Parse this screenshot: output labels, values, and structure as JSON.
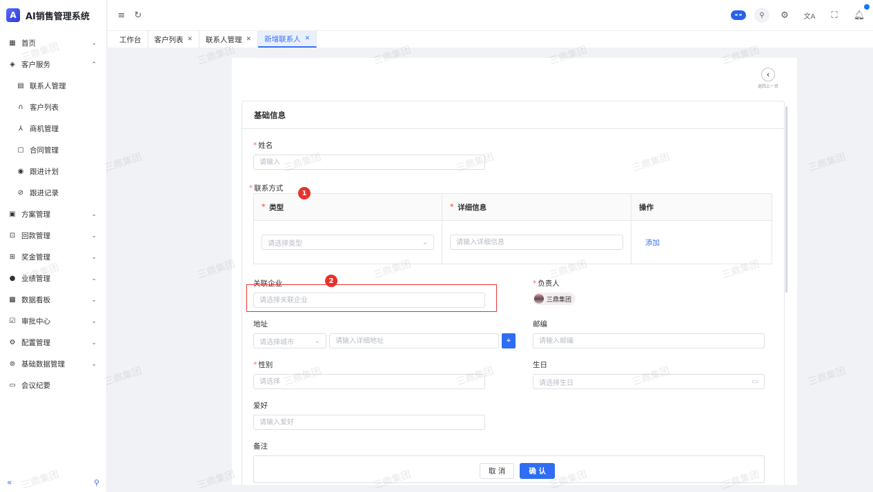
{
  "app": {
    "title": "AI销售管理系统",
    "logo_letter": "A"
  },
  "sidebar": {
    "items": [
      {
        "label": "首页",
        "icon": "grid-icon",
        "chev": "⌄"
      },
      {
        "label": "客户服务",
        "icon": "service-icon",
        "chev": "⌃"
      },
      {
        "label": "联系人管理",
        "icon": "contact-card-icon",
        "sub": true
      },
      {
        "label": "客户列表",
        "icon": "headset-icon",
        "sub": true
      },
      {
        "label": "商机管理",
        "icon": "network-icon",
        "sub": true
      },
      {
        "label": "合同管理",
        "icon": "document-icon",
        "sub": true
      },
      {
        "label": "跟进计划",
        "icon": "target-icon",
        "sub": true
      },
      {
        "label": "跟进记录",
        "icon": "compass-icon",
        "sub": true
      },
      {
        "label": "方案管理",
        "icon": "plan-icon",
        "chev": "⌄"
      },
      {
        "label": "回款管理",
        "icon": "payment-icon",
        "chev": "⌄"
      },
      {
        "label": "奖金管理",
        "icon": "bonus-icon",
        "chev": "⌄"
      },
      {
        "label": "业绩管理",
        "icon": "performance-icon",
        "chev": "⌄"
      },
      {
        "label": "数据看板",
        "icon": "dashboard-icon",
        "chev": "⌄"
      },
      {
        "label": "审批中心",
        "icon": "approval-icon",
        "chev": "⌄"
      },
      {
        "label": "配置管理",
        "icon": "gear-icon",
        "chev": "⌄"
      },
      {
        "label": "基础数据管理",
        "icon": "database-icon",
        "chev": "⌄"
      },
      {
        "label": "会议纪要",
        "icon": "meeting-icon"
      }
    ]
  },
  "tabs": [
    {
      "label": "工作台",
      "closable": false,
      "active": false
    },
    {
      "label": "客户列表",
      "closable": true,
      "active": false
    },
    {
      "label": "联系人管理",
      "closable": true,
      "active": false
    },
    {
      "label": "新增联系人",
      "closable": true,
      "active": true
    }
  ],
  "back": {
    "label": "返回上一页"
  },
  "form": {
    "section_title": "基础信息",
    "name": {
      "label": "姓名",
      "placeholder": "请输入"
    },
    "contact": {
      "label": "联系方式",
      "col_type": "类型",
      "col_detail": "详细信息",
      "col_action": "操作",
      "type_placeholder": "请选择类型",
      "detail_placeholder": "请输入详细信息",
      "add_label": "添加"
    },
    "company": {
      "label": "关联企业",
      "placeholder": "请选择关联企业"
    },
    "owner": {
      "label": "负责人",
      "value": "三鼎集团"
    },
    "address": {
      "label": "地址",
      "city_placeholder": "请选择城市",
      "detail_placeholder": "请输入详细地址"
    },
    "zip": {
      "label": "邮编",
      "placeholder": "请输入邮编"
    },
    "gender": {
      "label": "性别",
      "placeholder": "请选择"
    },
    "birthday": {
      "label": "生日",
      "placeholder": "请选择生日"
    },
    "hobby": {
      "label": "爱好",
      "placeholder": "请输入爱好"
    },
    "remark": {
      "label": "备注"
    }
  },
  "buttons": {
    "cancel": "取 消",
    "confirm": "确 认"
  },
  "markers": [
    "1",
    "2"
  ],
  "watermark": "三鼎集团",
  "colors": {
    "primary": "#2f6df2",
    "required": "#f56c6c",
    "marker": "#e8322b"
  }
}
